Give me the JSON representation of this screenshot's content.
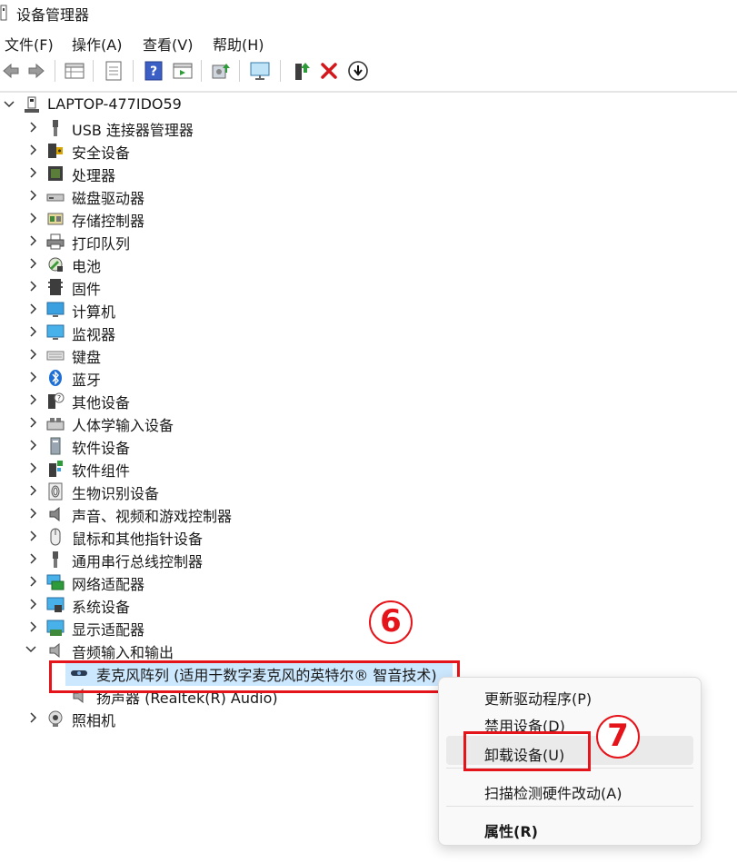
{
  "window": {
    "title": "设备管理器"
  },
  "menu": [
    "文件(F)",
    "操作(A)",
    "查看(V)",
    "帮助(H)"
  ],
  "toolbar": [
    "back-icon",
    "forward-icon",
    "properties-grid-icon",
    "document-icon",
    "help-icon",
    "view-icon",
    "update-driver-icon",
    "scan-monitor-icon",
    "enable-device-icon",
    "uninstall-icon",
    "download-icon"
  ],
  "tree": {
    "root": "LAPTOP-477IDO59",
    "categories": [
      {
        "label": "USB 连接器管理器",
        "icon": "usb-connector-icon"
      },
      {
        "label": "安全设备",
        "icon": "security-device-icon"
      },
      {
        "label": "处理器",
        "icon": "processor-icon"
      },
      {
        "label": "磁盘驱动器",
        "icon": "disk-drive-icon"
      },
      {
        "label": "存储控制器",
        "icon": "storage-controller-icon"
      },
      {
        "label": "打印队列",
        "icon": "printer-icon"
      },
      {
        "label": "电池",
        "icon": "battery-icon"
      },
      {
        "label": "固件",
        "icon": "firmware-icon"
      },
      {
        "label": "计算机",
        "icon": "computer-icon"
      },
      {
        "label": "监视器",
        "icon": "monitor-icon"
      },
      {
        "label": "键盘",
        "icon": "keyboard-icon"
      },
      {
        "label": "蓝牙",
        "icon": "bluetooth-icon"
      },
      {
        "label": "其他设备",
        "icon": "other-device-icon"
      },
      {
        "label": "人体学输入设备",
        "icon": "hid-icon"
      },
      {
        "label": "软件设备",
        "icon": "software-device-icon"
      },
      {
        "label": "软件组件",
        "icon": "software-component-icon"
      },
      {
        "label": "生物识别设备",
        "icon": "biometric-icon"
      },
      {
        "label": "声音、视频和游戏控制器",
        "icon": "sound-icon"
      },
      {
        "label": "鼠标和其他指针设备",
        "icon": "mouse-icon"
      },
      {
        "label": "通用串行总线控制器",
        "icon": "usb-controller-icon"
      },
      {
        "label": "网络适配器",
        "icon": "network-adapter-icon"
      },
      {
        "label": "系统设备",
        "icon": "system-device-icon"
      },
      {
        "label": "显示适配器",
        "icon": "display-adapter-icon"
      }
    ],
    "audio": {
      "label": "音频输入和输出",
      "children": [
        "麦克风阵列 (适用于数字麦克风的英特尔® 智音技术)",
        "扬声器 (Realtek(R) Audio)"
      ]
    },
    "camera": "照相机"
  },
  "context_menu": {
    "items": [
      "更新驱动程序(P)",
      "禁用设备(D)",
      "卸载设备(U)",
      "扫描检测硬件改动(A)",
      "属性(R)"
    ]
  },
  "annotations": {
    "step6": "6",
    "step7": "7"
  },
  "colors": {
    "highlight": "#e5141a",
    "selection": "#cce8ff"
  }
}
